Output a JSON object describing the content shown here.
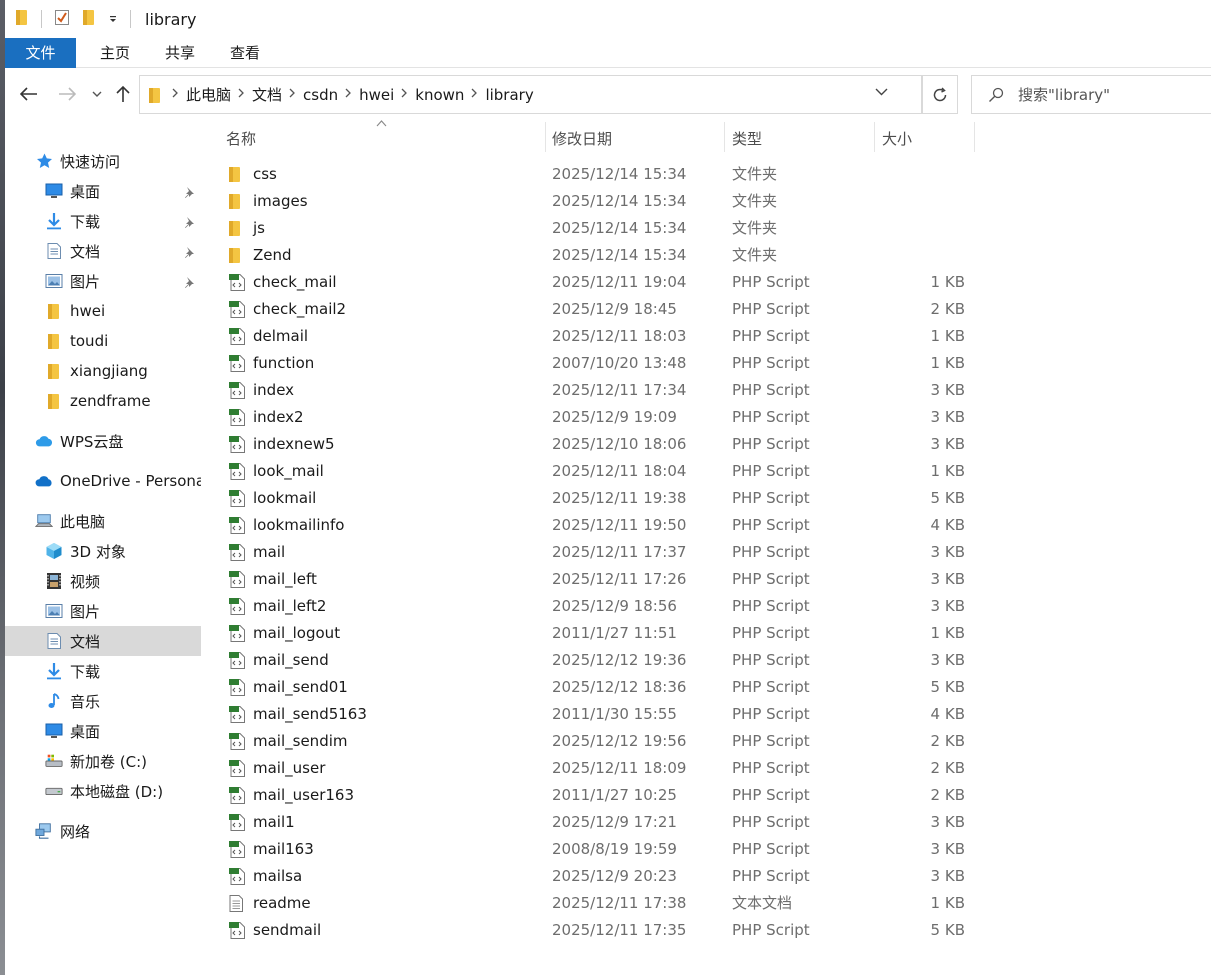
{
  "window": {
    "title": "library"
  },
  "ribbon": {
    "tabs": [
      "文件",
      "主页",
      "共享",
      "查看"
    ]
  },
  "address": {
    "breadcrumbs": [
      "此电脑",
      "文档",
      "csdn",
      "hwei",
      "known",
      "library"
    ],
    "search_placeholder": "搜索\"library\""
  },
  "nav_pane": {
    "items": [
      {
        "label": "快速访问",
        "icon": "star-icon",
        "level": 0,
        "pinned": false
      },
      {
        "label": "桌面",
        "icon": "desktop-icon",
        "level": 1,
        "pinned": true
      },
      {
        "label": "下载",
        "icon": "download-icon",
        "level": 1,
        "pinned": true
      },
      {
        "label": "文档",
        "icon": "document-icon",
        "level": 1,
        "pinned": true
      },
      {
        "label": "图片",
        "icon": "picture-icon",
        "level": 1,
        "pinned": true
      },
      {
        "label": "hwei",
        "icon": "folder-icon",
        "level": 1,
        "pinned": false
      },
      {
        "label": "toudi",
        "icon": "folder-icon",
        "level": 1,
        "pinned": false
      },
      {
        "label": "xiangjiang",
        "icon": "folder-icon",
        "level": 1,
        "pinned": false
      },
      {
        "label": "zendframe",
        "icon": "folder-icon",
        "level": 1,
        "pinned": false
      },
      {
        "label": "WPS云盘",
        "icon": "cloud-icon",
        "level": 0,
        "pinned": false
      },
      {
        "label": "OneDrive - Persona",
        "icon": "onedrive-icon",
        "level": 0,
        "pinned": false
      },
      {
        "label": "此电脑",
        "icon": "computer-icon",
        "level": 0,
        "pinned": false
      },
      {
        "label": "3D 对象",
        "icon": "3d-objects-icon",
        "level": 1,
        "pinned": false
      },
      {
        "label": "视频",
        "icon": "video-icon",
        "level": 1,
        "pinned": false
      },
      {
        "label": "图片",
        "icon": "picture-icon",
        "level": 1,
        "pinned": false
      },
      {
        "label": "文档",
        "icon": "document-icon",
        "level": 1,
        "pinned": false,
        "selected": true
      },
      {
        "label": "下载",
        "icon": "download-icon",
        "level": 1,
        "pinned": false
      },
      {
        "label": "音乐",
        "icon": "music-icon",
        "level": 1,
        "pinned": false
      },
      {
        "label": "桌面",
        "icon": "desktop-icon",
        "level": 1,
        "pinned": false
      },
      {
        "label": "新加卷 (C:)",
        "icon": "system-drive-icon",
        "level": 1,
        "pinned": false
      },
      {
        "label": "本地磁盘 (D:)",
        "icon": "drive-icon",
        "level": 1,
        "pinned": false
      },
      {
        "label": "网络",
        "icon": "network-icon",
        "level": 0,
        "pinned": false
      }
    ]
  },
  "columns": {
    "name": "名称",
    "date": "修改日期",
    "type": "类型",
    "size": "大小"
  },
  "files": [
    {
      "name": "css",
      "date": "2025/12/14 15:34",
      "type": "文件夹",
      "size": "",
      "icon": "folder-icon"
    },
    {
      "name": "images",
      "date": "2025/12/14 15:34",
      "type": "文件夹",
      "size": "",
      "icon": "folder-icon"
    },
    {
      "name": "js",
      "date": "2025/12/14 15:34",
      "type": "文件夹",
      "size": "",
      "icon": "folder-icon"
    },
    {
      "name": "Zend",
      "date": "2025/12/14 15:34",
      "type": "文件夹",
      "size": "",
      "icon": "folder-icon"
    },
    {
      "name": "check_mail",
      "date": "2025/12/11 19:04",
      "type": "PHP Script",
      "size": "1 KB",
      "icon": "php-file-icon"
    },
    {
      "name": "check_mail2",
      "date": "2025/12/9 18:45",
      "type": "PHP Script",
      "size": "2 KB",
      "icon": "php-file-icon"
    },
    {
      "name": "delmail",
      "date": "2025/12/11 18:03",
      "type": "PHP Script",
      "size": "1 KB",
      "icon": "php-file-icon"
    },
    {
      "name": "function",
      "date": "2007/10/20 13:48",
      "type": "PHP Script",
      "size": "1 KB",
      "icon": "php-file-icon"
    },
    {
      "name": "index",
      "date": "2025/12/11 17:34",
      "type": "PHP Script",
      "size": "3 KB",
      "icon": "php-file-icon"
    },
    {
      "name": "index2",
      "date": "2025/12/9 19:09",
      "type": "PHP Script",
      "size": "3 KB",
      "icon": "php-file-icon"
    },
    {
      "name": "indexnew5",
      "date": "2025/12/10 18:06",
      "type": "PHP Script",
      "size": "3 KB",
      "icon": "php-file-icon"
    },
    {
      "name": "look_mail",
      "date": "2025/12/11 18:04",
      "type": "PHP Script",
      "size": "1 KB",
      "icon": "php-file-icon"
    },
    {
      "name": "lookmail",
      "date": "2025/12/11 19:38",
      "type": "PHP Script",
      "size": "5 KB",
      "icon": "php-file-icon"
    },
    {
      "name": "lookmailinfo",
      "date": "2025/12/11 19:50",
      "type": "PHP Script",
      "size": "4 KB",
      "icon": "php-file-icon"
    },
    {
      "name": "mail",
      "date": "2025/12/11 17:37",
      "type": "PHP Script",
      "size": "3 KB",
      "icon": "php-file-icon"
    },
    {
      "name": "mail_left",
      "date": "2025/12/11 17:26",
      "type": "PHP Script",
      "size": "3 KB",
      "icon": "php-file-icon"
    },
    {
      "name": "mail_left2",
      "date": "2025/12/9 18:56",
      "type": "PHP Script",
      "size": "3 KB",
      "icon": "php-file-icon"
    },
    {
      "name": "mail_logout",
      "date": "2011/1/27 11:51",
      "type": "PHP Script",
      "size": "1 KB",
      "icon": "php-file-icon"
    },
    {
      "name": "mail_send",
      "date": "2025/12/12 19:36",
      "type": "PHP Script",
      "size": "3 KB",
      "icon": "php-file-icon"
    },
    {
      "name": "mail_send01",
      "date": "2025/12/12 18:36",
      "type": "PHP Script",
      "size": "5 KB",
      "icon": "php-file-icon"
    },
    {
      "name": "mail_send5163",
      "date": "2011/1/30 15:55",
      "type": "PHP Script",
      "size": "4 KB",
      "icon": "php-file-icon"
    },
    {
      "name": "mail_sendim",
      "date": "2025/12/12 19:56",
      "type": "PHP Script",
      "size": "2 KB",
      "icon": "php-file-icon"
    },
    {
      "name": "mail_user",
      "date": "2025/12/11 18:09",
      "type": "PHP Script",
      "size": "2 KB",
      "icon": "php-file-icon"
    },
    {
      "name": "mail_user163",
      "date": "2011/1/27 10:25",
      "type": "PHP Script",
      "size": "2 KB",
      "icon": "php-file-icon"
    },
    {
      "name": "mail1",
      "date": "2025/12/9 17:21",
      "type": "PHP Script",
      "size": "3 KB",
      "icon": "php-file-icon"
    },
    {
      "name": "mail163",
      "date": "2008/8/19 19:59",
      "type": "PHP Script",
      "size": "3 KB",
      "icon": "php-file-icon"
    },
    {
      "name": "mailsa",
      "date": "2025/12/9 20:23",
      "type": "PHP Script",
      "size": "3 KB",
      "icon": "php-file-icon"
    },
    {
      "name": "readme",
      "date": "2025/12/11 17:38",
      "type": "文本文档",
      "size": "1 KB",
      "icon": "text-file-icon"
    },
    {
      "name": "sendmail",
      "date": "2025/12/11 17:35",
      "type": "PHP Script",
      "size": "5 KB",
      "icon": "php-file-icon"
    }
  ],
  "colors": {
    "accent": "#1a6fc0",
    "folder": "#f4c542",
    "php_badge": "#2f7d32",
    "selected_bg": "#d9d9d9"
  }
}
